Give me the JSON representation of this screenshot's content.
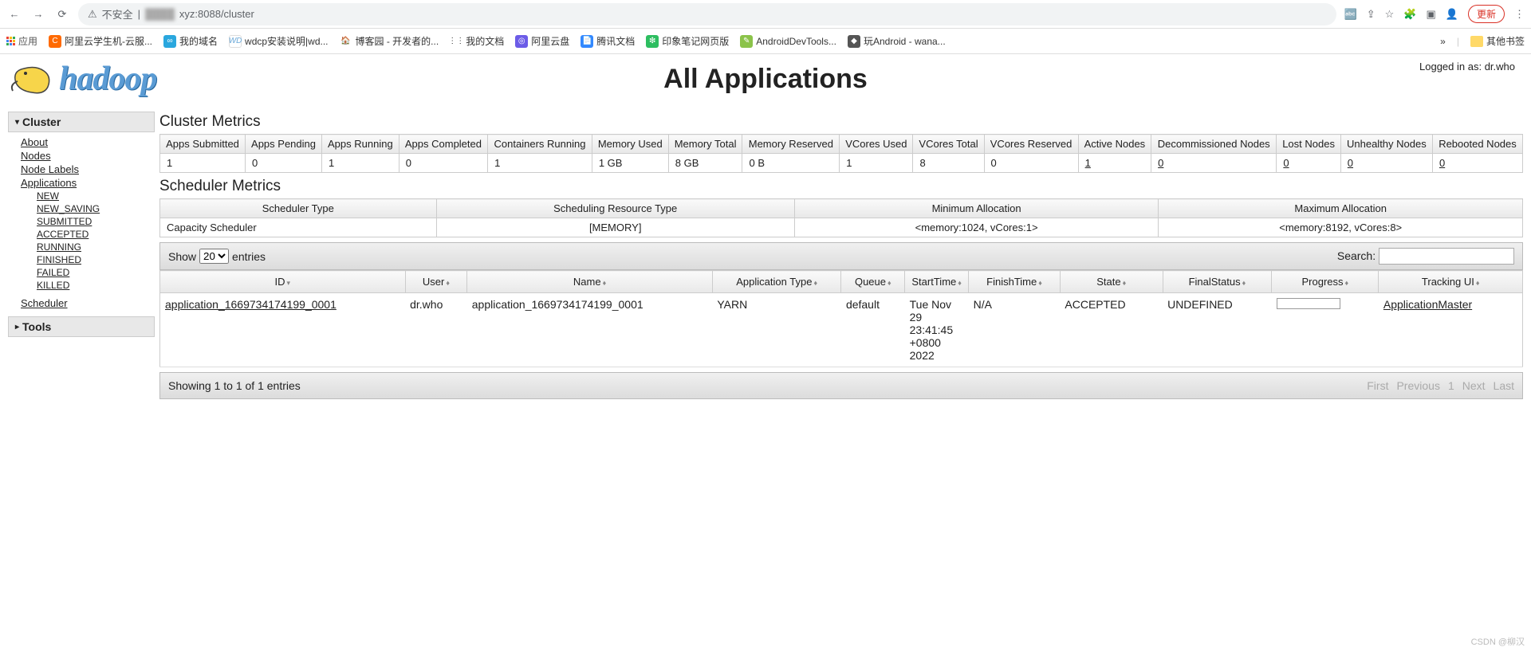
{
  "browser": {
    "insecure_label": "不安全",
    "url_suffix": "xyz:8088/cluster",
    "update_label": "更新"
  },
  "bookmarks": {
    "apps_label": "应用",
    "items": [
      {
        "label": "阿里云学生机-云服...",
        "color": "#ff6a00"
      },
      {
        "label": "我的域名",
        "color": "#2aa7de"
      },
      {
        "label": "wdcp安装说明|wd...",
        "color": "#6aa8d8",
        "text": "WD"
      },
      {
        "label": "博客园 - 开发者的...",
        "color": "#3b7",
        "glyph": "🏠"
      },
      {
        "label": "我的文档",
        "color": "#333",
        "glyph": "⋮⋮"
      },
      {
        "label": "阿里云盘",
        "color": "#6c5ce7",
        "glyph": "◎"
      },
      {
        "label": "腾讯文档",
        "color": "#3388ff",
        "glyph": "📄"
      },
      {
        "label": "印象笔记网页版",
        "color": "#2dbe60",
        "glyph": "🐘"
      },
      {
        "label": "AndroidDevTools...",
        "color": "#8bc34a",
        "glyph": "✎"
      },
      {
        "label": "玩Android - wana...",
        "color": "#555",
        "glyph": "◆"
      }
    ],
    "more": "»",
    "other_label": "其他书签"
  },
  "header": {
    "logo_text": "hadoop",
    "title": "All Applications",
    "logged_in": "Logged in as: dr.who"
  },
  "sidebar": {
    "cluster_label": "Cluster",
    "links": {
      "about": "About",
      "nodes": "Nodes",
      "node_labels": "Node Labels",
      "applications": "Applications",
      "scheduler": "Scheduler"
    },
    "app_states": [
      "NEW",
      "NEW_SAVING",
      "SUBMITTED",
      "ACCEPTED",
      "RUNNING",
      "FINISHED",
      "FAILED",
      "KILLED"
    ],
    "tools_label": "Tools"
  },
  "cluster_metrics": {
    "title": "Cluster Metrics",
    "headers": [
      "Apps Submitted",
      "Apps Pending",
      "Apps Running",
      "Apps Completed",
      "Containers Running",
      "Memory Used",
      "Memory Total",
      "Memory Reserved",
      "VCores Used",
      "VCores Total",
      "VCores Reserved",
      "Active Nodes",
      "Decommissioned Nodes",
      "Lost Nodes",
      "Unhealthy Nodes",
      "Rebooted Nodes"
    ],
    "values": [
      "1",
      "0",
      "1",
      "0",
      "1",
      "1 GB",
      "8 GB",
      "0 B",
      "1",
      "8",
      "0",
      "1",
      "0",
      "0",
      "0",
      "0"
    ]
  },
  "scheduler_metrics": {
    "title": "Scheduler Metrics",
    "headers": [
      "Scheduler Type",
      "Scheduling Resource Type",
      "Minimum Allocation",
      "Maximum Allocation"
    ],
    "values": [
      "Capacity Scheduler",
      "[MEMORY]",
      "<memory:1024, vCores:1>",
      "<memory:8192, vCores:8>"
    ]
  },
  "datatable": {
    "show_label": "Show",
    "entries_label": "entries",
    "show_value": "20",
    "search_label": "Search:",
    "columns": [
      "ID",
      "User",
      "Name",
      "Application Type",
      "Queue",
      "StartTime",
      "FinishTime",
      "State",
      "FinalStatus",
      "Progress",
      "Tracking UI"
    ],
    "row": {
      "id": "application_1669734174199_0001",
      "user": "dr.who",
      "name": "application_1669734174199_0001",
      "app_type": "YARN",
      "queue": "default",
      "start_time": "Tue Nov 29 23:41:45 +0800 2022",
      "finish_time": "N/A",
      "state": "ACCEPTED",
      "final_status": "UNDEFINED",
      "tracking_ui": "ApplicationMaster"
    },
    "footer_info": "Showing 1 to 1 of 1 entries",
    "pag": {
      "first": "First",
      "prev": "Previous",
      "page": "1",
      "next": "Next",
      "last": "Last"
    }
  },
  "watermark": "CSDN @柳汉"
}
